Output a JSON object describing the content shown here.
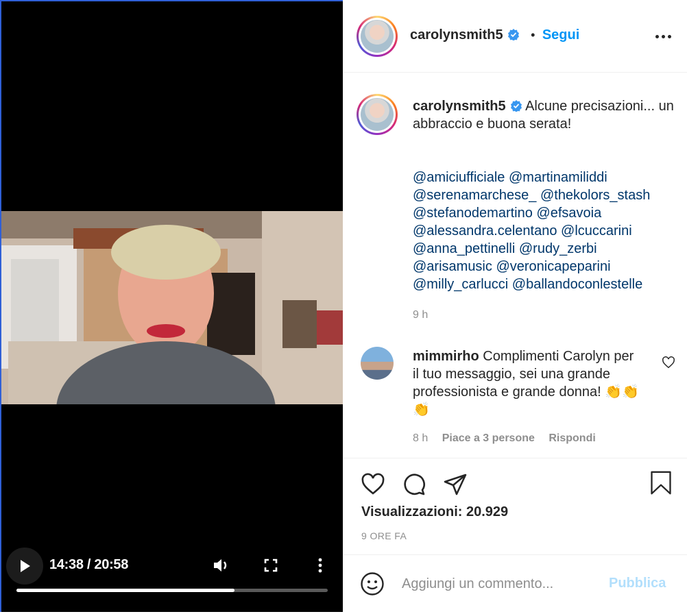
{
  "video": {
    "current_time": "14:38",
    "duration": "20:58",
    "time_label": "14:38 / 20:58",
    "progress_fraction": 0.7
  },
  "header": {
    "username": "carolynsmith5",
    "separator": "•",
    "follow_label": "Segui"
  },
  "caption": {
    "username": "carolynsmith5",
    "text": "Alcune precisazioni... un abbraccio e buona serata!",
    "mentions": [
      "@amiciufficiale",
      "@martinamiliddi",
      "@serenamarchese_",
      "@thekolors_stash",
      "@stefanodemartino",
      "@efsavoia",
      "@alessandra.celentano",
      "@lcuccarini",
      "@anna_pettinelli",
      "@rudy_zerbi",
      "@arisamusic",
      "@veronicapeparini",
      "@milly_carlucci",
      "@ballandoconlestelle"
    ],
    "time": "9 h"
  },
  "comment": {
    "username": "mimmirho",
    "text": "Complimenti Carolyn per il tuo messaggio, sei una grande professionista e grande donna! 👏👏👏",
    "time": "8 h",
    "likes": "Piace a 3 persone",
    "reply": "Rispondi"
  },
  "stats": {
    "views": "Visualizzazioni: 20.929",
    "posted": "9 ORE FA"
  },
  "add_comment": {
    "placeholder": "Aggiungi un commento...",
    "publish_label": "Pubblica"
  },
  "colors": {
    "accent": "#0095f6",
    "link": "#00376b",
    "muted": "#8e8e8e",
    "publish_disabled": "#b2dffc",
    "video_bg": "#000000"
  },
  "icons": [
    "play-icon",
    "volume-icon",
    "fullscreen-icon",
    "kebab-icon",
    "verified-icon",
    "more-icon",
    "heart-icon",
    "comment-icon",
    "share-icon",
    "bookmark-icon",
    "emoji-icon"
  ]
}
